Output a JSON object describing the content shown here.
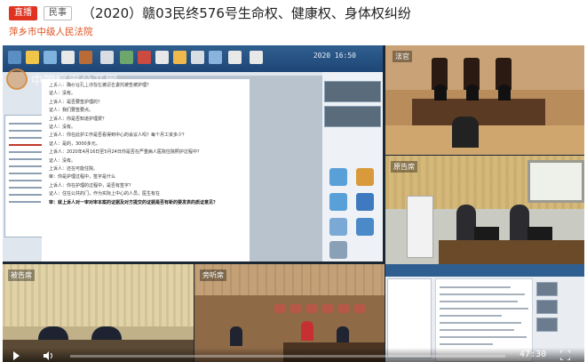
{
  "header": {
    "live_badge": "直播",
    "category_badge": "民事",
    "case_title": "（2020）赣03民终576号生命权、健康权、身体权纠纷",
    "court_name": "萍乡市中级人民法院"
  },
  "video": {
    "watermark": "中国庭审公开网",
    "screen_time": "2020 16:50",
    "cameras": {
      "bench_label": "法官",
      "plaintiff_label": "原告席",
      "defendant_label": "被告席",
      "gallery_label": "旁听席"
    },
    "transcript_lines": [
      "上诉人：确存在孔上存着在被原告委托被告被护理？",
      "证人：没有。",
      "上诉人：是否要签护理的？",
      "证人：我们要签要点。",
      "上诉人：你是否知道护理费？",
      "证人：没有。",
      "上诉人：你在此护工作是否看得到中心的会议人吗？每个月工资多少？",
      "证人：是的，3000多元。",
      "上诉人：2020年4月16日至5月24日你是否在严重病人医院住院照护过程中？",
      "证人：没有。",
      "上诉人：还在可能住院。",
      "审：你是护理过程中，签字是什么",
      "上诉人：你在护理的过程中，是否有签字？",
      "证人：住在公共的门，作为实际上中心的人员，医生有在"
    ],
    "transcript_bold": "审：就上诉人对一审对审本案的证据及对方提交的证据是否有新的要发表的质证意见？",
    "controls": {
      "duration": "47:30",
      "progress": 0.0
    }
  },
  "colors": {
    "live_red": "#e0321f",
    "court_orange": "#e0501f",
    "app_blue": "#2f5f90"
  }
}
